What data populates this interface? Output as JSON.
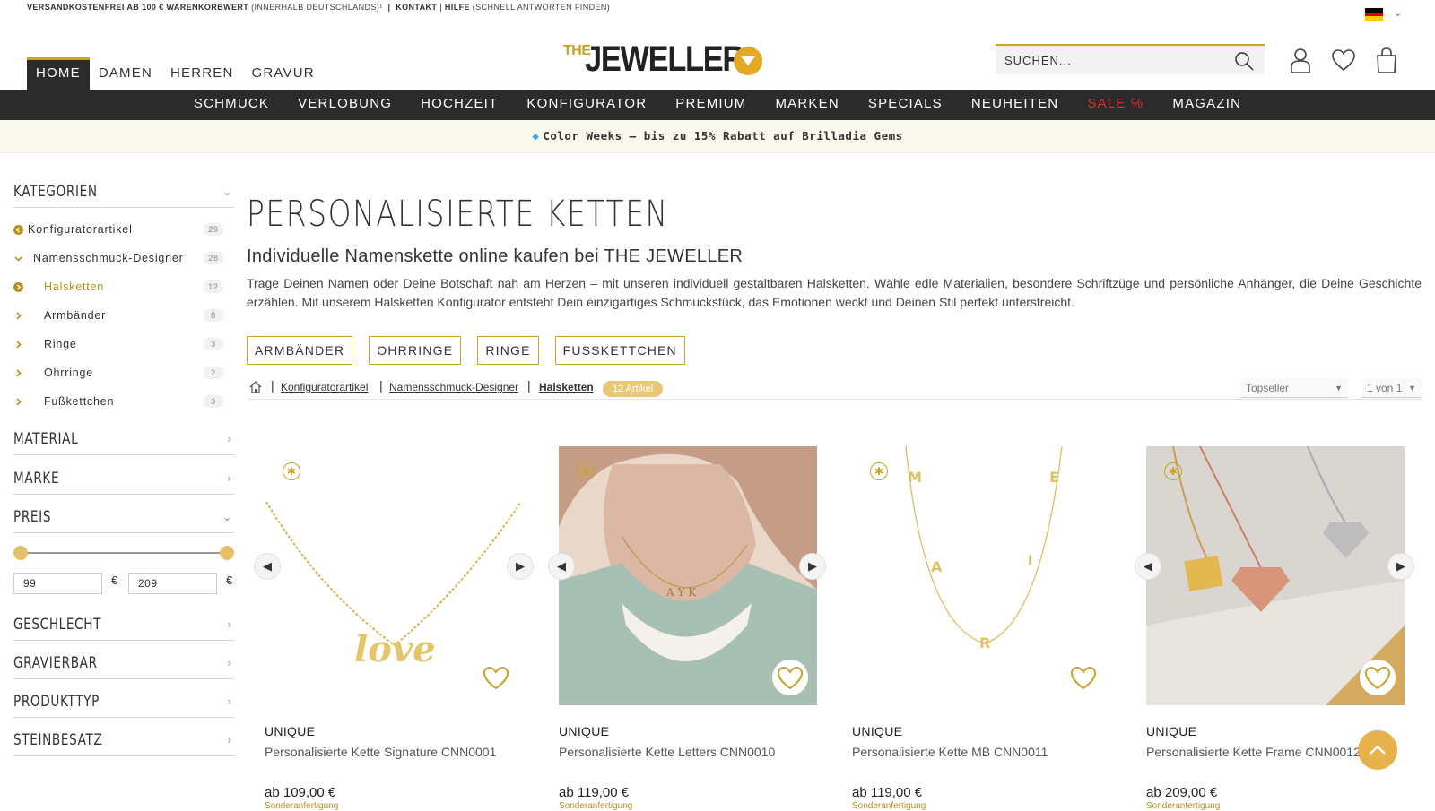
{
  "topbar": {
    "shipping_bold": "VERSANDKOSTENFREI AB 100 € WARENKORBWERT",
    "shipping_note": "(INNERHALB DEUTSCHLANDS)¹",
    "divider": "|",
    "contact": "KONTAKT",
    "help_sep": "|",
    "help": "HILFE",
    "help_note": "(SCHNELL ANTWORTEN FINDEN)"
  },
  "gender_nav": [
    "HOME",
    "DAMEN",
    "HERREN",
    "GRAVUR"
  ],
  "logo": {
    "prefix": "THE",
    "name": "JEWELLER"
  },
  "search": {
    "placeholder": "SUCHEN..."
  },
  "main_nav": [
    "SCHMUCK",
    "VERLOBUNG",
    "HOCHZEIT",
    "KONFIGURATOR",
    "PREMIUM",
    "MARKEN",
    "SPECIALS",
    "NEUHEITEN",
    "SALE %",
    "MAGAZIN"
  ],
  "promo": {
    "text": "Color Weeks – bis zu 15% Rabatt auf Brilladia Gems"
  },
  "sidebar": {
    "categories_title": "KATEGORIEN",
    "categories": [
      {
        "label": "Konfiguratorartikel",
        "count": "29"
      },
      {
        "label": "Namensschmuck-Designer",
        "count": "28"
      },
      {
        "label": "Halsketten",
        "count": "12"
      },
      {
        "label": "Armbänder",
        "count": "8"
      },
      {
        "label": "Ringe",
        "count": "3"
      },
      {
        "label": "Ohrringe",
        "count": "2"
      },
      {
        "label": "Fußkettchen",
        "count": "3"
      }
    ],
    "filters": {
      "material": "MATERIAL",
      "marke": "MARKE",
      "preis": "PREIS",
      "geschlecht": "GESCHLECHT",
      "gravierbar": "GRAVIERBAR",
      "produkttyp": "PRODUKTTYP",
      "steinbesatz": "STEINBESATZ"
    },
    "price_min": "99",
    "price_max": "209",
    "currency": "€"
  },
  "content": {
    "title": "PERSONALISIERTE KETTEN",
    "subtitle": "Individuelle Namenskette online kaufen bei THE JEWELLER",
    "description": "Trage Deinen Namen oder Deine Botschaft nah am Herzen – mit unseren individuell gestaltbaren Halsketten. Wähle edle Materialien, besondere Schriftzüge und persönliche Anhänger, die Deine Geschichte erzählen. Mit unserem Halsketten Konfigurator entsteht Dein einzigartiges Schmuckstück, das Emotionen weckt und Deinen Stil perfekt unterstreicht.",
    "chips": [
      "ARMBÄNDER",
      "OHRRINGE",
      "RINGE",
      "FUSSKETTCHEN"
    ],
    "breadcrumbs": [
      "Konfiguratorartikel",
      "Namensschmuck-Designer",
      "Halsketten"
    ],
    "article_count": "12 Artikel",
    "sort": "Topseller",
    "pagination": "1 von 1"
  },
  "products": [
    {
      "brand": "UNIQUE",
      "name": "Personalisierte Kette Signature CNN0001",
      "price": "ab 109,00 €",
      "note": "Sonderanfertigung"
    },
    {
      "brand": "UNIQUE",
      "name": "Personalisierte Kette Letters CNN0010",
      "price": "ab 119,00 €",
      "note": "Sonderanfertigung"
    },
    {
      "brand": "UNIQUE",
      "name": "Personalisierte Kette MB CNN0011",
      "price": "ab 119,00 €",
      "note": "Sonderanfertigung"
    },
    {
      "brand": "UNIQUE",
      "name": "Personalisierte Kette Frame CNN0012",
      "price": "ab 209,00 €",
      "note": "Sonderanfertigung"
    }
  ],
  "colors": {
    "gold": "#c9a227",
    "dark": "#2b2b2b",
    "sale": "#e02b2b"
  }
}
